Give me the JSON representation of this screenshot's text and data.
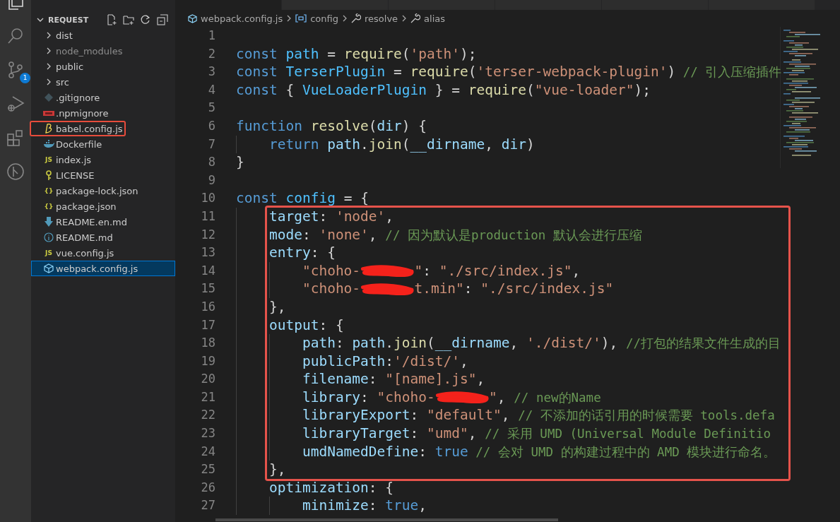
{
  "activity_bar": {
    "items": [
      {
        "selected": true
      },
      {
        "selected": false
      },
      {
        "selected": false,
        "badge": "1"
      },
      {
        "selected": false
      },
      {
        "selected": false
      },
      {
        "selected": false
      }
    ]
  },
  "explorer": {
    "title": "REQUEST",
    "expanded": true,
    "items": [
      {
        "kind": "folder",
        "name": "dist",
        "expanded": false,
        "dimmed": false,
        "selected": false,
        "highlighted": false
      },
      {
        "kind": "folder",
        "name": "node_modules",
        "expanded": false,
        "dimmed": true,
        "selected": false,
        "highlighted": false
      },
      {
        "kind": "folder",
        "name": "public",
        "expanded": false,
        "dimmed": false,
        "selected": false,
        "highlighted": false
      },
      {
        "kind": "folder",
        "name": "src",
        "expanded": false,
        "dimmed": false,
        "selected": false,
        "highlighted": false
      },
      {
        "kind": "git",
        "name": ".gitignore",
        "dimmed": false,
        "selected": false,
        "highlighted": false
      },
      {
        "kind": "npm",
        "name": ".npmignore",
        "dimmed": false,
        "selected": false,
        "highlighted": false
      },
      {
        "kind": "babel",
        "name": "babel.config.js",
        "dimmed": false,
        "selected": false,
        "highlighted": true
      },
      {
        "kind": "docker",
        "name": "Dockerfile",
        "dimmed": false,
        "selected": false,
        "highlighted": false
      },
      {
        "kind": "badge",
        "icon_text": "JS",
        "name": "index.js",
        "dimmed": false,
        "selected": false,
        "highlighted": false
      },
      {
        "kind": "license",
        "name": "LICENSE",
        "dimmed": false,
        "selected": false,
        "highlighted": false
      },
      {
        "kind": "badge",
        "icon_text": "{}",
        "name": "package-lock.json",
        "dimmed": false,
        "selected": false,
        "highlighted": false
      },
      {
        "kind": "badge",
        "icon_text": "{}",
        "name": "package.json",
        "dimmed": false,
        "selected": false,
        "highlighted": false
      },
      {
        "kind": "download",
        "name": "README.en.md",
        "dimmed": false,
        "selected": false,
        "highlighted": false
      },
      {
        "kind": "info",
        "name": "README.md",
        "dimmed": false,
        "selected": false,
        "highlighted": false
      },
      {
        "kind": "badge",
        "icon_text": "JS",
        "name": "vue.config.js",
        "dimmed": false,
        "selected": false,
        "highlighted": false
      },
      {
        "kind": "webpack",
        "name": "webpack.config.js",
        "dimmed": false,
        "selected": true,
        "highlighted": false
      }
    ]
  },
  "breadcrumb": [
    "webpack.config.js",
    "config",
    "resolve",
    "alias"
  ],
  "code": {
    "lines": [
      {
        "n": "1",
        "highlighted": false
      },
      {
        "n": "2",
        "highlighted": false,
        "tokens": [
          {
            "kind": "kw",
            "t": "const "
          },
          {
            "kind": "var",
            "t": "path"
          },
          {
            "kind": "p",
            "t": " = "
          },
          {
            "kind": "fn",
            "t": "require"
          },
          {
            "kind": "p",
            "t": "("
          },
          {
            "kind": "str",
            "t": "'path'"
          },
          {
            "kind": "p",
            "t": ");"
          }
        ]
      },
      {
        "n": "3",
        "highlighted": false,
        "tokens": [
          {
            "kind": "kw",
            "t": "const "
          },
          {
            "kind": "var",
            "t": "TerserPlugin"
          },
          {
            "kind": "p",
            "t": " = "
          },
          {
            "kind": "fn",
            "t": "require"
          },
          {
            "kind": "p",
            "t": "("
          },
          {
            "kind": "str",
            "t": "'terser-webpack-plugin'"
          },
          {
            "kind": "p",
            "t": ")"
          },
          {
            "kind": "com",
            "t": " // 引入压缩插件"
          }
        ]
      },
      {
        "n": "4",
        "highlighted": false,
        "tokens": [
          {
            "kind": "kw",
            "t": "const "
          },
          {
            "kind": "p",
            "t": "{ "
          },
          {
            "kind": "var",
            "t": "VueLoaderPlugin"
          },
          {
            "kind": "p",
            "t": " } = "
          },
          {
            "kind": "fn",
            "t": "require"
          },
          {
            "kind": "p",
            "t": "("
          },
          {
            "kind": "str",
            "t": "\"vue-loader\""
          },
          {
            "kind": "p",
            "t": ");"
          }
        ]
      },
      {
        "n": "5",
        "highlighted": false
      },
      {
        "n": "6",
        "highlighted": false,
        "tokens": [
          {
            "kind": "kw",
            "t": "function "
          },
          {
            "kind": "fn",
            "t": "resolve"
          },
          {
            "kind": "p",
            "t": "("
          },
          {
            "kind": "prop",
            "t": "dir"
          },
          {
            "kind": "p",
            "t": ") {"
          }
        ]
      },
      {
        "n": "7",
        "highlighted": false,
        "tokens": [
          {
            "kind": "kw",
            "t": "    return "
          },
          {
            "kind": "prop",
            "t": "path"
          },
          {
            "kind": "p",
            "t": "."
          },
          {
            "kind": "fn",
            "t": "join"
          },
          {
            "kind": "p",
            "t": "("
          },
          {
            "kind": "prop",
            "t": "__dirname"
          },
          {
            "kind": "p",
            "t": ", "
          },
          {
            "kind": "prop",
            "t": "dir"
          },
          {
            "kind": "p",
            "t": ")"
          }
        ]
      },
      {
        "n": "8",
        "highlighted": false,
        "tokens": [
          {
            "kind": "p",
            "t": "}"
          }
        ]
      },
      {
        "n": "9",
        "highlighted": false
      },
      {
        "n": "10",
        "highlighted": false,
        "tokens": [
          {
            "kind": "kw",
            "t": "const "
          },
          {
            "kind": "var",
            "t": "config"
          },
          {
            "kind": "p",
            "t": " = {"
          }
        ]
      },
      {
        "n": "11",
        "highlighted": true,
        "tokens": [
          {
            "kind": "prop",
            "t": "    target"
          },
          {
            "kind": "p",
            "t": ": "
          },
          {
            "kind": "str",
            "t": "'node'"
          },
          {
            "kind": "p",
            "t": ","
          }
        ]
      },
      {
        "n": "12",
        "highlighted": true,
        "tokens": [
          {
            "kind": "prop",
            "t": "    mode"
          },
          {
            "kind": "p",
            "t": ": "
          },
          {
            "kind": "str",
            "t": "'none'"
          },
          {
            "kind": "p",
            "t": ", "
          },
          {
            "kind": "com",
            "t": "// 因为默认是production 默认会进行压缩"
          }
        ]
      },
      {
        "n": "13",
        "highlighted": true,
        "tokens": [
          {
            "kind": "prop",
            "t": "    entry"
          },
          {
            "kind": "p",
            "t": ": {"
          }
        ]
      },
      {
        "n": "14",
        "highlighted": true,
        "tokens": [
          {
            "kind": "str",
            "t": "        \"choho-"
          },
          {
            "kind": "redaction"
          },
          {
            "kind": "str",
            "t": "\""
          },
          {
            "kind": "p",
            "t": ": "
          },
          {
            "kind": "str",
            "t": "\"./src/index.js\""
          },
          {
            "kind": "p",
            "t": ","
          }
        ]
      },
      {
        "n": "15",
        "highlighted": true,
        "tokens": [
          {
            "kind": "str",
            "t": "        \"choho-"
          },
          {
            "kind": "redaction"
          },
          {
            "kind": "str",
            "t": "t.min\""
          },
          {
            "kind": "p",
            "t": ": "
          },
          {
            "kind": "str",
            "t": "\"./src/index.js\""
          }
        ]
      },
      {
        "n": "16",
        "highlighted": true,
        "tokens": [
          {
            "kind": "p",
            "t": "    },"
          }
        ]
      },
      {
        "n": "17",
        "highlighted": true,
        "tokens": [
          {
            "kind": "prop",
            "t": "    output"
          },
          {
            "kind": "p",
            "t": ": {"
          }
        ]
      },
      {
        "n": "18",
        "highlighted": true,
        "tokens": [
          {
            "kind": "prop",
            "t": "        path"
          },
          {
            "kind": "p",
            "t": ": "
          },
          {
            "kind": "prop",
            "t": "path"
          },
          {
            "kind": "p",
            "t": "."
          },
          {
            "kind": "fn",
            "t": "join"
          },
          {
            "kind": "p",
            "t": "("
          },
          {
            "kind": "prop",
            "t": "__dirname"
          },
          {
            "kind": "p",
            "t": ", "
          },
          {
            "kind": "str",
            "t": "'./dist/'"
          },
          {
            "kind": "p",
            "t": "), "
          },
          {
            "kind": "com",
            "t": "//打包的结果文件生成的目"
          }
        ]
      },
      {
        "n": "19",
        "highlighted": true,
        "tokens": [
          {
            "kind": "prop",
            "t": "        publicPath"
          },
          {
            "kind": "p",
            "t": ":"
          },
          {
            "kind": "str",
            "t": "'/dist/'"
          },
          {
            "kind": "p",
            "t": ","
          }
        ]
      },
      {
        "n": "20",
        "highlighted": true,
        "tokens": [
          {
            "kind": "prop",
            "t": "        filename"
          },
          {
            "kind": "p",
            "t": ": "
          },
          {
            "kind": "str",
            "t": "\"[name].js\""
          },
          {
            "kind": "p",
            "t": ","
          }
        ]
      },
      {
        "n": "21",
        "highlighted": true,
        "tokens": [
          {
            "kind": "prop",
            "t": "        library"
          },
          {
            "kind": "p",
            "t": ": "
          },
          {
            "kind": "str",
            "t": "\"choho-"
          },
          {
            "kind": "redaction"
          },
          {
            "kind": "str",
            "t": "\""
          },
          {
            "kind": "p",
            "t": ", "
          },
          {
            "kind": "com",
            "t": "// new的Name"
          }
        ]
      },
      {
        "n": "22",
        "highlighted": true,
        "tokens": [
          {
            "kind": "prop",
            "t": "        libraryExport"
          },
          {
            "kind": "p",
            "t": ": "
          },
          {
            "kind": "str",
            "t": "\"default\""
          },
          {
            "kind": "p",
            "t": ", "
          },
          {
            "kind": "com",
            "t": "// 不添加的话引用的时候需要 tools.defa"
          }
        ]
      },
      {
        "n": "23",
        "highlighted": true,
        "tokens": [
          {
            "kind": "prop",
            "t": "        libraryTarget"
          },
          {
            "kind": "p",
            "t": ": "
          },
          {
            "kind": "str",
            "t": "\"umd\""
          },
          {
            "kind": "p",
            "t": ", "
          },
          {
            "kind": "com",
            "t": "// 采用 UMD (Universal Module Definitio"
          }
        ]
      },
      {
        "n": "24",
        "highlighted": true,
        "tokens": [
          {
            "kind": "prop",
            "t": "        umdNamedDefine"
          },
          {
            "kind": "p",
            "t": ": "
          },
          {
            "kind": "kw",
            "t": "true"
          },
          {
            "kind": "com",
            "t": " // 会对 UMD 的构建过程中的 AMD 模块进行命名。"
          }
        ]
      },
      {
        "n": "25",
        "highlighted": true,
        "tokens": [
          {
            "kind": "p",
            "t": "    },"
          }
        ]
      },
      {
        "n": "26",
        "highlighted": false,
        "tokens": [
          {
            "kind": "prop",
            "t": "    optimization"
          },
          {
            "kind": "p",
            "t": ": {"
          }
        ]
      },
      {
        "n": "27",
        "highlighted": false,
        "tokens": [
          {
            "kind": "prop",
            "t": "        minimize"
          },
          {
            "kind": "p",
            "t": ": "
          },
          {
            "kind": "kw",
            "t": "true"
          },
          {
            "kind": "p",
            "t": ","
          }
        ]
      }
    ]
  }
}
